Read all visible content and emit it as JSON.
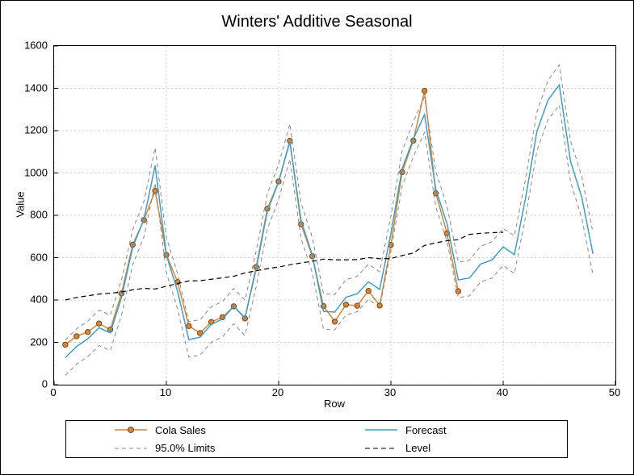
{
  "chart_data": {
    "type": "line",
    "title": "Winters' Additive Seasonal",
    "xlabel": "Row",
    "ylabel": "Value",
    "xlim": [
      0,
      50
    ],
    "ylim": [
      0,
      1600
    ],
    "x_ticks": [
      0,
      10,
      20,
      30,
      40,
      50
    ],
    "y_ticks": [
      0,
      200,
      400,
      600,
      800,
      1000,
      1200,
      1400,
      1600
    ],
    "grid": true,
    "legend_position": "bottom",
    "series": [
      {
        "name": "Cola Sales",
        "color": "#d98533",
        "style": "line-marker",
        "x": [
          1,
          2,
          3,
          4,
          5,
          6,
          7,
          8,
          9,
          10,
          11,
          12,
          13,
          14,
          15,
          16,
          17,
          18,
          19,
          20,
          21,
          22,
          23,
          24,
          25,
          26,
          27,
          28,
          29,
          30,
          31,
          32,
          33,
          34,
          35,
          36
        ],
        "values": [
          189,
          229,
          249,
          289,
          260,
          431,
          661,
          778,
          916,
          613,
          485,
          277,
          244,
          296,
          319,
          370,
          313,
          556,
          832,
          960,
          1152,
          758,
          607,
          371,
          298,
          378,
          373,
          443,
          374,
          660,
          1004,
          1153,
          1388,
          904,
          715,
          441
        ]
      },
      {
        "name": "Forecast",
        "color": "#3a9fc9",
        "style": "line",
        "x": [
          1,
          2,
          3,
          4,
          5,
          6,
          7,
          8,
          9,
          10,
          11,
          12,
          13,
          14,
          15,
          16,
          17,
          18,
          19,
          20,
          21,
          22,
          23,
          24,
          25,
          26,
          27,
          28,
          29,
          30,
          31,
          32,
          33,
          34,
          35,
          36,
          37,
          38,
          39,
          40,
          41,
          42,
          43,
          44,
          45,
          46,
          47,
          48
        ],
        "values": [
          128,
          180,
          217,
          269,
          245,
          411,
          649,
          782,
          1035,
          613,
          441,
          213,
          224,
          285,
          310,
          371,
          316,
          547,
          820,
          958,
          1148,
          774,
          612,
          346,
          343,
          413,
          429,
          486,
          450,
          714,
          1020,
          1161,
          1276,
          923,
          760,
          495,
          504,
          570,
          589,
          651,
          614,
          883,
          1195,
          1345,
          1416,
          1055,
          886,
          618
        ]
      },
      {
        "name": "95.0% Limits",
        "color": "#888888",
        "style": "dashed-pair",
        "x": [
          1,
          2,
          3,
          4,
          5,
          6,
          7,
          8,
          9,
          10,
          11,
          12,
          13,
          14,
          15,
          16,
          17,
          18,
          19,
          20,
          21,
          22,
          23,
          24,
          25,
          26,
          27,
          28,
          29,
          30,
          31,
          32,
          33,
          34,
          35,
          36,
          37,
          38,
          39,
          40,
          41,
          42,
          43,
          44,
          45,
          46,
          47,
          48
        ],
        "upper": [
          211,
          264,
          300,
          352,
          328,
          495,
          733,
          865,
          1119,
          696,
          524,
          297,
          307,
          368,
          393,
          455,
          399,
          631,
          903,
          1042,
          1232,
          857,
          695,
          429,
          426,
          496,
          512,
          569,
          533,
          797,
          1104,
          1244,
          1359,
          1007,
          843,
          578,
          588,
          654,
          675,
          738,
          703,
          973,
          1287,
          1438,
          1511,
          1152,
          984,
          718
        ],
        "lower": [
          44,
          97,
          133,
          185,
          161,
          328,
          566,
          698,
          952,
          529,
          357,
          130,
          140,
          201,
          226,
          288,
          232,
          464,
          736,
          875,
          1065,
          690,
          528,
          262,
          259,
          329,
          345,
          402,
          367,
          630,
          937,
          1077,
          1192,
          840,
          676,
          411,
          420,
          486,
          503,
          564,
          525,
          793,
          1103,
          1252,
          1321,
          958,
          787,
          518
        ]
      },
      {
        "name": "Level",
        "color": "#000000",
        "style": "dashed",
        "x": [
          1,
          2,
          3,
          4,
          5,
          6,
          7,
          8,
          9,
          10,
          11,
          12,
          13,
          14,
          15,
          16,
          17,
          18,
          19,
          20,
          21,
          22,
          23,
          24,
          25,
          26,
          27,
          28,
          29,
          30,
          31,
          32,
          33,
          34,
          35,
          36,
          37,
          38,
          39,
          40
        ],
        "values": [
          400,
          412,
          420,
          428,
          432,
          438,
          448,
          455,
          452,
          465,
          478,
          490,
          491,
          498,
          505,
          512,
          528,
          538,
          548,
          556,
          566,
          575,
          583,
          593,
          590,
          590,
          591,
          600,
          595,
          596,
          610,
          622,
          658,
          670,
          680,
          685,
          710,
          715,
          718,
          720
        ]
      }
    ],
    "legend": [
      "Cola Sales",
      "Forecast",
      "95.0% Limits",
      "Level"
    ]
  }
}
